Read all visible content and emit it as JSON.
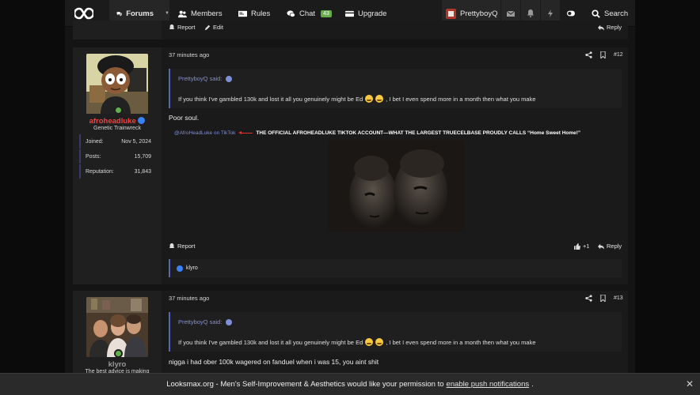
{
  "nav": {
    "forums": "Forums",
    "members": "Members",
    "rules": "Rules",
    "chat": "Chat",
    "chat_badge": "43",
    "upgrade": "Upgrade",
    "user": "PrettyboyQ",
    "search": "Search"
  },
  "top_post": {
    "report": "Report",
    "edit": "Edit",
    "reply": "Reply"
  },
  "post12": {
    "time": "37 minutes ago",
    "number": "#12",
    "author": {
      "name": "afroheadluke",
      "title": "Genetic Trainwreck",
      "joined_label": "Joined:",
      "joined": "Nov 5, 2024",
      "posts_label": "Posts:",
      "posts": "15,709",
      "rep_label": "Reputation:",
      "rep": "31,843"
    },
    "quote": {
      "author": "PrettyboyQ said:",
      "text_a": "If you think I've gambled 130k and lost it all you genuinely might be Ed",
      "text_b": ", I bet I even spend more in a month then what you make"
    },
    "body": "Poor soul.",
    "sig_link": "@AfroHeadLuke on TikTok",
    "sig_text": "THE OFFICIAL AFROHEADLUKE TIKTOK ACCOUNT—WHAT THE LARGEST TRUECELBASE PROUDLY CALLS “Home Sweet Home!”",
    "report": "Report",
    "likes": "+1",
    "reply": "Reply",
    "reaction_user": "klyro"
  },
  "post13": {
    "time": "37 minutes ago",
    "number": "#13",
    "author": {
      "name": "klyro",
      "title": "The best advice is making"
    },
    "quote": {
      "author": "PrettyboyQ said:",
      "text_a": "If you think I've gambled 130k and lost it all you genuinely might be Ed",
      "text_b": ", I bet I even spend more in a month then what you make"
    },
    "body": "nigga i had ober 100k wagered on fanduel when i was 15, you aint shit"
  },
  "notice": {
    "text": "Looksmax.org - Men's Self-Improvement & Aesthetics would like your permission to",
    "link": "enable push notifications",
    "end": "."
  },
  "colors": {
    "accent": "#5864b5",
    "username_red": "#ec4543",
    "online": "#61b04d"
  }
}
